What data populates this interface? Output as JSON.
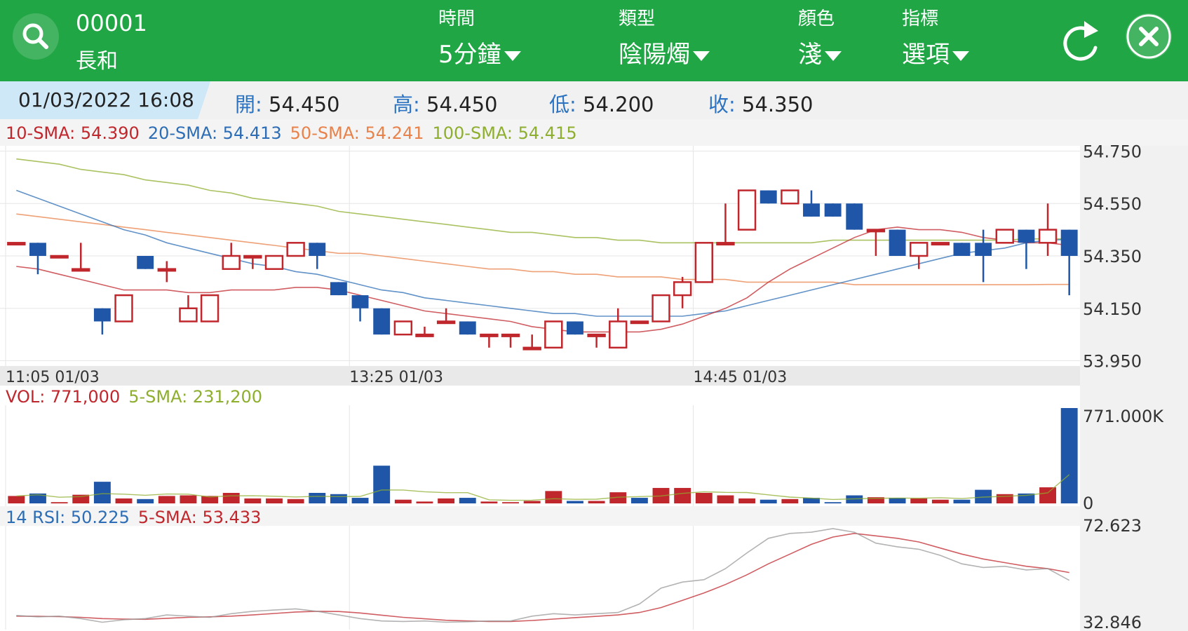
{
  "header": {
    "symbol_code": "00001",
    "symbol_name": "長和",
    "menus": [
      {
        "label": "時間",
        "value": "5分鐘"
      },
      {
        "label": "類型",
        "value": "陰陽燭"
      },
      {
        "label": "顏色",
        "value": "淺"
      },
      {
        "label": "指標",
        "value": "選項"
      }
    ]
  },
  "info": {
    "datetime": "01/03/2022  16:08",
    "open_label": "開:",
    "open": "54.450",
    "high_label": "高:",
    "high": "54.450",
    "low_label": "低:",
    "low": "54.200",
    "close_label": "收:",
    "close": "54.350"
  },
  "colors": {
    "header_green": "#21a645",
    "up_red": "#c0272d",
    "down_blue": "#1f56a8",
    "sma10": "#c0272d",
    "sma20": "#2c6db5",
    "sma50": "#e8824a",
    "sma100": "#8dae2e"
  },
  "chart_data": [
    {
      "type": "candlestick",
      "legend": [
        {
          "label": "10-SMA: 54.390",
          "color": "#c0272d"
        },
        {
          "label": "20-SMA: 54.413",
          "color": "#2c6db5"
        },
        {
          "label": "50-SMA: 54.241",
          "color": "#e8824a"
        },
        {
          "label": "100-SMA: 54.415",
          "color": "#8dae2e"
        }
      ],
      "yticks": [
        "54.750",
        "54.550",
        "54.350",
        "54.150",
        "53.950"
      ],
      "ylim": [
        53.93,
        54.77
      ],
      "xticks": [
        {
          "index": 0,
          "label": "11:05 01/03"
        },
        {
          "index": 16,
          "label": "13:25 01/03"
        },
        {
          "index": 32,
          "label": "14:45 01/03"
        }
      ],
      "candles": [
        {
          "o": 54.4,
          "h": 54.4,
          "l": 54.4,
          "c": 54.4
        },
        {
          "o": 54.4,
          "h": 54.4,
          "l": 54.28,
          "c": 54.35
        },
        {
          "o": 54.35,
          "h": 54.35,
          "l": 54.35,
          "c": 54.35
        },
        {
          "o": 54.3,
          "h": 54.4,
          "l": 54.3,
          "c": 54.3
        },
        {
          "o": 54.15,
          "h": 54.15,
          "l": 54.05,
          "c": 54.1
        },
        {
          "o": 54.1,
          "h": 54.2,
          "l": 54.1,
          "c": 54.2
        },
        {
          "o": 54.35,
          "h": 54.35,
          "l": 54.3,
          "c": 54.3
        },
        {
          "o": 54.3,
          "h": 54.33,
          "l": 54.25,
          "c": 54.3
        },
        {
          "o": 54.1,
          "h": 54.2,
          "l": 54.1,
          "c": 54.15
        },
        {
          "o": 54.1,
          "h": 54.2,
          "l": 54.1,
          "c": 54.2
        },
        {
          "o": 54.3,
          "h": 54.4,
          "l": 54.3,
          "c": 54.35
        },
        {
          "o": 54.35,
          "h": 54.35,
          "l": 54.3,
          "c": 54.35
        },
        {
          "o": 54.3,
          "h": 54.35,
          "l": 54.3,
          "c": 54.35
        },
        {
          "o": 54.35,
          "h": 54.4,
          "l": 54.35,
          "c": 54.4
        },
        {
          "o": 54.4,
          "h": 54.4,
          "l": 54.3,
          "c": 54.35
        },
        {
          "o": 54.25,
          "h": 54.25,
          "l": 54.2,
          "c": 54.2
        },
        {
          "o": 54.2,
          "h": 54.2,
          "l": 54.1,
          "c": 54.15
        },
        {
          "o": 54.15,
          "h": 54.15,
          "l": 54.05,
          "c": 54.05
        },
        {
          "o": 54.05,
          "h": 54.1,
          "l": 54.05,
          "c": 54.1
        },
        {
          "o": 54.05,
          "h": 54.08,
          "l": 54.05,
          "c": 54.05
        },
        {
          "o": 54.1,
          "h": 54.15,
          "l": 54.1,
          "c": 54.1
        },
        {
          "o": 54.1,
          "h": 54.1,
          "l": 54.05,
          "c": 54.05
        },
        {
          "o": 54.05,
          "h": 54.05,
          "l": 54.0,
          "c": 54.05
        },
        {
          "o": 54.05,
          "h": 54.05,
          "l": 54.0,
          "c": 54.05
        },
        {
          "o": 54.0,
          "h": 54.05,
          "l": 54.0,
          "c": 54.0
        },
        {
          "o": 54.0,
          "h": 54.1,
          "l": 54.0,
          "c": 54.1
        },
        {
          "o": 54.1,
          "h": 54.1,
          "l": 54.05,
          "c": 54.05
        },
        {
          "o": 54.05,
          "h": 54.05,
          "l": 54.0,
          "c": 54.05
        },
        {
          "o": 54.0,
          "h": 54.15,
          "l": 54.0,
          "c": 54.1
        },
        {
          "o": 54.1,
          "h": 54.1,
          "l": 54.1,
          "c": 54.1
        },
        {
          "o": 54.1,
          "h": 54.15,
          "l": 54.1,
          "c": 54.2
        },
        {
          "o": 54.2,
          "h": 54.27,
          "l": 54.15,
          "c": 54.25
        },
        {
          "o": 54.25,
          "h": 54.4,
          "l": 54.25,
          "c": 54.4
        },
        {
          "o": 54.4,
          "h": 54.55,
          "l": 54.4,
          "c": 54.4
        },
        {
          "o": 54.45,
          "h": 54.6,
          "l": 54.45,
          "c": 54.6
        },
        {
          "o": 54.6,
          "h": 54.6,
          "l": 54.55,
          "c": 54.55
        },
        {
          "o": 54.55,
          "h": 54.6,
          "l": 54.55,
          "c": 54.6
        },
        {
          "o": 54.55,
          "h": 54.6,
          "l": 54.5,
          "c": 54.5
        },
        {
          "o": 54.55,
          "h": 54.55,
          "l": 54.5,
          "c": 54.5
        },
        {
          "o": 54.55,
          "h": 54.55,
          "l": 54.45,
          "c": 54.45
        },
        {
          "o": 54.45,
          "h": 54.45,
          "l": 54.35,
          "c": 54.45
        },
        {
          "o": 54.45,
          "h": 54.45,
          "l": 54.35,
          "c": 54.35
        },
        {
          "o": 54.35,
          "h": 54.4,
          "l": 54.3,
          "c": 54.4
        },
        {
          "o": 54.4,
          "h": 54.4,
          "l": 54.4,
          "c": 54.4
        },
        {
          "o": 54.4,
          "h": 54.4,
          "l": 54.35,
          "c": 54.35
        },
        {
          "o": 54.4,
          "h": 54.45,
          "l": 54.25,
          "c": 54.35
        },
        {
          "o": 54.4,
          "h": 54.45,
          "l": 54.4,
          "c": 54.45
        },
        {
          "o": 54.45,
          "h": 54.45,
          "l": 54.3,
          "c": 54.4
        },
        {
          "o": 54.4,
          "h": 54.55,
          "l": 54.35,
          "c": 54.45
        },
        {
          "o": 54.45,
          "h": 54.45,
          "l": 54.2,
          "c": 54.35
        }
      ],
      "sma10": [
        54.31,
        54.3,
        54.28,
        54.26,
        54.24,
        54.22,
        54.22,
        54.22,
        54.21,
        54.21,
        54.22,
        54.22,
        54.22,
        54.23,
        54.23,
        54.22,
        54.2,
        54.18,
        54.16,
        54.14,
        54.13,
        54.12,
        54.11,
        54.1,
        54.08,
        54.07,
        54.06,
        54.06,
        54.06,
        54.06,
        54.07,
        54.09,
        54.12,
        54.15,
        54.19,
        54.25,
        54.3,
        54.34,
        54.38,
        54.42,
        54.45,
        54.46,
        54.45,
        54.45,
        54.44,
        54.42,
        54.41,
        54.4,
        54.4,
        54.39
      ],
      "sma20": [
        54.6,
        54.57,
        54.54,
        54.51,
        54.48,
        54.45,
        54.43,
        54.4,
        54.38,
        54.36,
        54.34,
        54.32,
        54.31,
        54.29,
        54.28,
        54.26,
        54.24,
        54.22,
        54.21,
        54.19,
        54.18,
        54.17,
        54.16,
        54.15,
        54.14,
        54.13,
        54.13,
        54.12,
        54.12,
        54.12,
        54.12,
        54.12,
        54.13,
        54.14,
        54.16,
        54.18,
        54.2,
        54.22,
        54.24,
        54.26,
        54.28,
        54.3,
        54.32,
        54.34,
        54.36,
        54.37,
        54.38,
        54.4,
        54.41,
        54.413
      ],
      "sma50": [
        54.51,
        54.5,
        54.49,
        54.48,
        54.47,
        54.46,
        54.45,
        54.44,
        54.43,
        54.42,
        54.41,
        54.4,
        54.39,
        54.38,
        54.37,
        54.36,
        54.36,
        54.35,
        54.34,
        54.33,
        54.32,
        54.31,
        54.3,
        54.3,
        54.29,
        54.29,
        54.28,
        54.28,
        54.27,
        54.27,
        54.27,
        54.26,
        54.26,
        54.26,
        54.25,
        54.25,
        54.25,
        54.25,
        54.25,
        54.24,
        54.24,
        54.24,
        54.24,
        54.24,
        54.24,
        54.24,
        54.24,
        54.24,
        54.241,
        54.241
      ],
      "sma100": [
        54.72,
        54.71,
        54.7,
        54.68,
        54.67,
        54.66,
        54.64,
        54.63,
        54.62,
        54.6,
        54.59,
        54.57,
        54.56,
        54.55,
        54.54,
        54.52,
        54.51,
        54.5,
        54.49,
        54.48,
        54.47,
        54.46,
        54.45,
        54.44,
        54.44,
        54.43,
        54.42,
        54.42,
        54.41,
        54.41,
        54.4,
        54.4,
        54.4,
        54.4,
        54.4,
        54.4,
        54.4,
        54.4,
        54.41,
        54.41,
        54.41,
        54.41,
        54.41,
        54.41,
        54.41,
        54.41,
        54.41,
        54.415,
        54.415,
        54.415
      ]
    },
    {
      "type": "bar",
      "legend": [
        {
          "label": "VOL: 771,000",
          "color": "#c0272d"
        },
        {
          "label": "5-SMA: 231,200",
          "color": "#8dae2e"
        }
      ],
      "yticks": [
        "771.000K",
        "0"
      ],
      "ylim": [
        0,
        771000
      ],
      "values": [
        60000,
        80000,
        10000,
        70000,
        175000,
        40000,
        35000,
        60000,
        65000,
        60000,
        85000,
        40000,
        40000,
        35000,
        85000,
        75000,
        45000,
        305000,
        30000,
        15000,
        40000,
        45000,
        15000,
        10000,
        20000,
        100000,
        20000,
        20000,
        90000,
        45000,
        125000,
        125000,
        85000,
        65000,
        40000,
        30000,
        35000,
        45000,
        10000,
        65000,
        50000,
        45000,
        40000,
        30000,
        30000,
        110000,
        75000,
        80000,
        130000,
        771000
      ],
      "up": [
        true,
        false,
        true,
        true,
        false,
        true,
        false,
        true,
        true,
        true,
        true,
        true,
        true,
        true,
        false,
        false,
        false,
        false,
        true,
        true,
        true,
        false,
        true,
        true,
        true,
        true,
        false,
        true,
        true,
        false,
        true,
        true,
        true,
        true,
        true,
        false,
        true,
        false,
        false,
        false,
        true,
        false,
        true,
        true,
        false,
        false,
        true,
        false,
        true,
        false
      ]
    },
    {
      "type": "line",
      "legend": [
        {
          "label": "14 RSI: 50.225",
          "color": "#2c6db5"
        },
        {
          "label": "5-SMA: 53.433",
          "color": "#c0272d"
        }
      ],
      "yticks": [
        "72.623",
        "32.846"
      ],
      "ylim": [
        32.846,
        72.623
      ],
      "rsi": [
        35.8,
        35.2,
        35.5,
        34.5,
        33.0,
        34.0,
        34.5,
        36.0,
        35.5,
        35.0,
        36.5,
        37.5,
        38.0,
        38.5,
        37.5,
        36.0,
        34.5,
        33.5,
        33.3,
        33.5,
        33.0,
        33.2,
        33.5,
        33.5,
        35.5,
        36.5,
        36.0,
        36.5,
        37.0,
        40.5,
        47.0,
        49.5,
        50.5,
        55.0,
        61.5,
        67.5,
        69.5,
        70.0,
        71.5,
        70.0,
        65.5,
        64.0,
        63.0,
        60.5,
        57.0,
        55.5,
        56.0,
        54.5,
        55.0,
        50.225
      ],
      "rsi_sma": [
        35.5,
        35.4,
        35.3,
        35.0,
        34.5,
        34.3,
        34.2,
        34.6,
        35.0,
        35.2,
        35.5,
        36.0,
        36.6,
        37.2,
        37.5,
        37.4,
        36.8,
        35.9,
        35.0,
        34.4,
        33.8,
        33.5,
        33.3,
        33.3,
        33.7,
        34.3,
        34.9,
        35.4,
        36.0,
        37.0,
        39.0,
        42.0,
        45.0,
        48.5,
        52.5,
        57.0,
        61.0,
        65.0,
        68.0,
        69.5,
        68.5,
        67.5,
        66.0,
        63.5,
        61.0,
        59.0,
        57.5,
        56.0,
        55.0,
        53.433
      ]
    }
  ]
}
